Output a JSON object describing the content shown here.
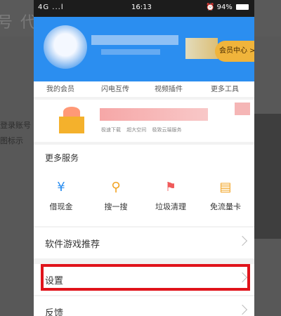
{
  "background": {
    "title_fragment": "号 代",
    "hint_line1": "登录账号",
    "hint_line2": "图标示"
  },
  "status_bar": {
    "signal": "4G ...l",
    "time": "16:13",
    "battery": "94%",
    "alarm_icon": "alarm-icon"
  },
  "header": {
    "member_center": "会员中心 >",
    "bg_color": "#2b8ef0"
  },
  "quick_links": [
    "我的会员",
    "闪电互传",
    "视频插件",
    "更多工具"
  ],
  "promo": {
    "subtitles": [
      "极速下载",
      "超大空间",
      "极致云端服务"
    ]
  },
  "services": {
    "title": "更多服务",
    "items": [
      {
        "label": "借现金",
        "icon": "cash-icon",
        "color": "#2b8ef0"
      },
      {
        "label": "搜一搜",
        "icon": "search-icon",
        "color": "#f2a322"
      },
      {
        "label": "垃圾清理",
        "icon": "broom-icon",
        "color": "#f05a5a"
      },
      {
        "label": "免流量卡",
        "icon": "card-icon",
        "color": "#f2a322"
      }
    ]
  },
  "menu": {
    "software_recommend": "软件游戏推荐",
    "settings": "设置",
    "feedback": "反馈"
  },
  "highlight_color": "#e0141b"
}
